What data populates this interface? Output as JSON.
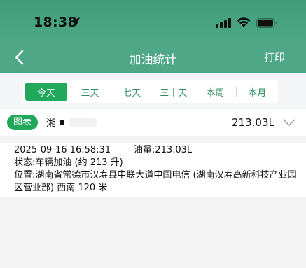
{
  "status_bar": {
    "time": "18:38"
  },
  "nav": {
    "title": "加油统计",
    "print_label": "打印"
  },
  "tabs": [
    {
      "label": "今天",
      "active": true
    },
    {
      "label": "三天",
      "active": false
    },
    {
      "label": "七天",
      "active": false
    },
    {
      "label": "三十天",
      "active": false
    },
    {
      "label": "本周",
      "active": false
    },
    {
      "label": "本月",
      "active": false
    }
  ],
  "vehicle": {
    "badge": "图表",
    "plate": "湘",
    "total_volume": "213.03L"
  },
  "record": {
    "time": "2025-09-16 16:58:31",
    "amount": "油量:213.03L",
    "state": "状态:车辆加油 (约 213 升)",
    "location": "位置:湖南省常德市汉寿县中联大道中国电信 (湖南汉寿高新科技产业园区营业部) 西南 120 米"
  },
  "colors": {
    "header": "#4ea887",
    "accent": "#22a85a",
    "tab_text": "#2f8f63"
  }
}
